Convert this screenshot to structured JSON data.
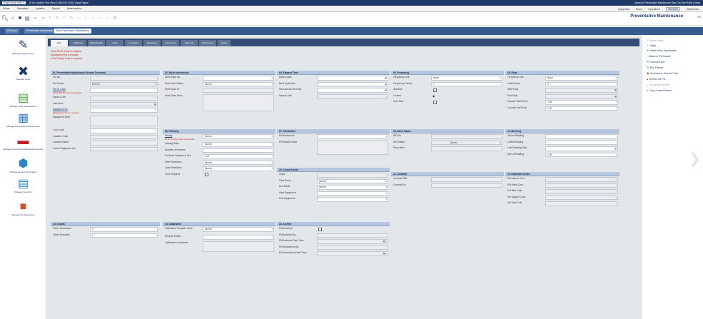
{
  "topbar": {
    "tabs": [
      "Pager Intune Help E",
      "JE Air Daylight Time (Wed 11/06/2019 16:52)  Signal  Signal"
    ],
    "right": "Signed in Preventative Maintenance  Sign Out  |  My Profile  |  About"
  },
  "menubar": {
    "left": [
      "Printer",
      "Operations",
      "Logistics",
      "Support",
      "Administration"
    ],
    "right": [
      "Equipment",
      "Stock",
      "Operations",
      "PM Work",
      "Material Ma"
    ]
  },
  "page_title": "Preventative Maintenance",
  "page_title_suffix": "RS",
  "nav_tabs": [
    "PM Work",
    "Preventative Maintenance List",
    "New Preventative Maintenance"
  ],
  "sub_tabs": [
    "Main",
    "Additional",
    "Safety Details",
    "Tasks",
    "Instruction",
    "Equipment",
    "Resources",
    "Materials",
    "Attachments",
    "Notes"
  ],
  "alerts": [
    "The PM ID Code is required",
    "Equipment No is required",
    "The Priority Code is required"
  ],
  "left_nav": [
    "Manage Support Items",
    "Maintain Tools",
    "Manage Work Specifications",
    "Manage Preventative Maintenance",
    "Manage Preventative Maintenance Routes",
    "Manage Service Summaries",
    "Manage Inventory",
    "Manage Fire Equipment"
  ],
  "panel01": {
    "title": "01. Preventative Maintenance Header Summary",
    "pm_no": "PM No",
    "pm_status": "PM Status",
    "pm_status_val": "Not Set",
    "pm_id_code": "PM ID Code",
    "pm_id_err": "The PM ID Code is required",
    "days_to_due": "Days to Due",
    "last_done": "Last Done",
    "equipment_no": "Equipment No",
    "equip_err": "Equipment No is required",
    "equipment_desc": "Equipment Desc",
    "cost_code": "Cost Code",
    "location_code": "Location Code",
    "location_name": "Location Name",
    "parent_equip": "Parent Equipment No"
  },
  "panel02": {
    "title": "02. Work Instructions",
    "work_spec_no": "Work Spec No",
    "work_user_status": "Work User Status",
    "work_user_status_val": "(None)",
    "work_spec_id": "Work Spec ID",
    "work_spec_desc": "Work Spec Desc"
  },
  "panel03": {
    "title": "03. Elapsed Time",
    "datum_date": "Datum Date",
    "next_cycle_due": "Next Cycle Due",
    "new_annual": "New Annual Set Date",
    "days_to_due": "Days to Due"
  },
  "panel04": {
    "title": "04. Frequency",
    "freq_unit": "Frequency Unit",
    "freq_unit_val": "None",
    "freq_period": "Frequency Period",
    "freq_period_val": "1",
    "absolute": "Absolute",
    "looked": "Looked",
    "auto_plan": "Auto Plan"
  },
  "panel05": {
    "title": "05. Float",
    "freq_unit": "Frequency Unit",
    "freq_unit_val": "None",
    "float_period": "Float Period",
    "float_period_val": "0",
    "start_float": "Start Float",
    "end_float": "End Float",
    "counter_start": "Counter Start Float",
    "counter_start_val": "1.00",
    "counter_end": "Counter End Float",
    "counter_end_val": "1.00"
  },
  "panel06": {
    "title": "06. Planning",
    "priority": "Priority",
    "priority_val": "(None)",
    "priority_err": "The Priority Code is required",
    "owning_team": "Owning Team",
    "owning_team_val": "(None)",
    "num_workers": "Number of Workers",
    "est_duration": "Est Work Duration in Hrs",
    "est_duration_val": "0.00",
    "time_restriction": "Time Restriction",
    "time_restriction_val": "(None)",
    "load_restriction": "Load Restriction",
    "load_restriction_val": "(None)",
    "dvd_required": "DVD Required"
  },
  "panel07": {
    "title": "07. PM Module",
    "pm_module_no": "PM Module No",
    "pm_module_desc": "PM Module Desc"
  },
  "panel08": {
    "title": "08. Work Status",
    "wo_no": "WO No",
    "wo_status": "WO Status",
    "wo_status_val": "(None)",
    "plan_label": "Plan Label"
  },
  "panel09": {
    "title": "09. Metering",
    "datum_reading": "Datum Reading",
    "latest_reading": "Latest Reading",
    "last_reading_date": "Last Reading Date",
    "due_at_reading": "Due at Reading",
    "due_at_reading_val": "1.00"
  },
  "panel10": {
    "title": "10. Linear Assets",
    "origin": "Origin",
    "start_route": "Start Route",
    "start_route_val": "(None)",
    "end_route": "End Route",
    "end_route_val": "(None)",
    "start_equipment": "Start Equipment",
    "end_equipment": "End Equipment"
  },
  "panel11": {
    "title": "11. Contract",
    "contract_title": "Contract Title",
    "contract_no": "Contract No"
  },
  "panel12": {
    "title": "12. Estimated Costs",
    "est_labour": "Est Labour Cost",
    "est_stock": "Est Stock Cost",
    "est_misc": "Est Misc Cost",
    "est_support": "Est Support Cost",
    "est_total": "Est Total Cost"
  },
  "panel13": {
    "title": "13. Counts",
    "times_generated": "Times Generated",
    "times_generated_val": "0",
    "times_executed": "Times Executed",
    "times_executed_val": "0"
  },
  "panel14": {
    "title": "14. Calibration",
    "cal_template": "Calibration Template Code",
    "cal_template_val": "(None)",
    "decimal_points": "Decimal Points",
    "cal_comments": "Calibration Comments"
  },
  "panel15": {
    "title": "15. Archive",
    "pm_archived": "PM Archived",
    "pm_archived_by": "PM Archived By",
    "pm_archived_dt": "PM Archived Date Time",
    "pm_unarchived_by": "PM Unarchived By",
    "pm_unarchived_dt": "PM Unarchived Date Time"
  },
  "right_actions": [
    {
      "label": "Reset Fields",
      "icon": "↺",
      "grey": true
    },
    {
      "label": "Apply",
      "icon": "✓",
      "grey": false
    },
    {
      "label": "Attach Work Specification",
      "icon": "⊕",
      "grey": false
    },
    {
      "label": "Attach to PM Module",
      "icon": "▪",
      "grey": false
    },
    {
      "label": "Generate WO",
      "icon": "⚒",
      "grey": false
    },
    {
      "label": "Run Planner",
      "icon": "☰",
      "grey": false
    },
    {
      "label": "Restrictions, Dvd and Time",
      "icon": "▣",
      "grey": false
    },
    {
      "label": "Archive the PM",
      "icon": "■",
      "grey": false
    },
    {
      "label": "Un-archive the PM",
      "icon": "□",
      "grey": true
    },
    {
      "label": "Copy Current Record",
      "icon": "●",
      "grey": false
    }
  ]
}
